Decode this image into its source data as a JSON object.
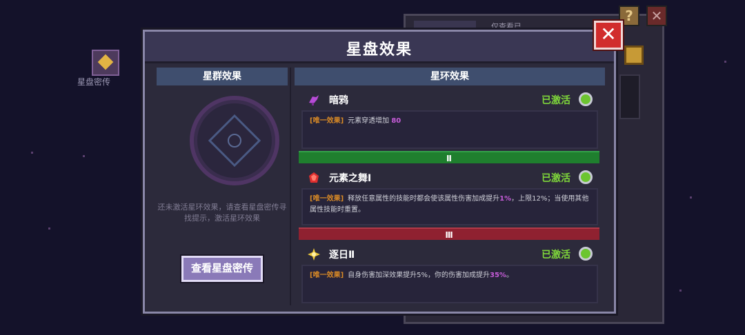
{
  "background": {
    "left_icon_label": "星盘密传",
    "back_panel_text": "仅查看已",
    "help_label": "?",
    "back_close_label": "✕"
  },
  "modal": {
    "title": "星盘效果",
    "close_label": "✕"
  },
  "left_column": {
    "header": "星群效果",
    "description": "还未激活星环效果，请查看星盘密传寻找提示，激活星环效果",
    "button_label": "查看星盘密传"
  },
  "right_column": {
    "header": "星环效果",
    "tier_2_label": "Ⅱ",
    "tier_3_label": "Ⅲ",
    "effects": [
      {
        "icon": "raven-icon",
        "name": "暗鸦",
        "status": "已激活",
        "tag": "[唯一效果]",
        "desc_before": "元素穿透增加 ",
        "highlight": "80",
        "desc_after": ""
      },
      {
        "icon": "ruby-gem-icon",
        "name": "元素之舞Ⅰ",
        "status": "已激活",
        "tag": "[唯一效果]",
        "desc_before": "释放任意属性的技能时都会使该属性伤害加成提升",
        "highlight": "1%",
        "desc_after": "，上限12%；当使用其他属性技能时重置。"
      },
      {
        "icon": "sun-icon",
        "name": "逐日Ⅱ",
        "status": "已激活",
        "tag": "[唯一效果]",
        "desc_before": "自身伤害加深效果提升5%，你的伤害加成提升",
        "highlight": "35%",
        "desc_after": "。"
      }
    ]
  },
  "colors": {
    "active_green": "#7fd73a",
    "tag_orange": "#d98a26",
    "highlight_purple": "#c65cd8",
    "tier_2": "#1f7f2e",
    "tier_3": "#8f2130"
  }
}
